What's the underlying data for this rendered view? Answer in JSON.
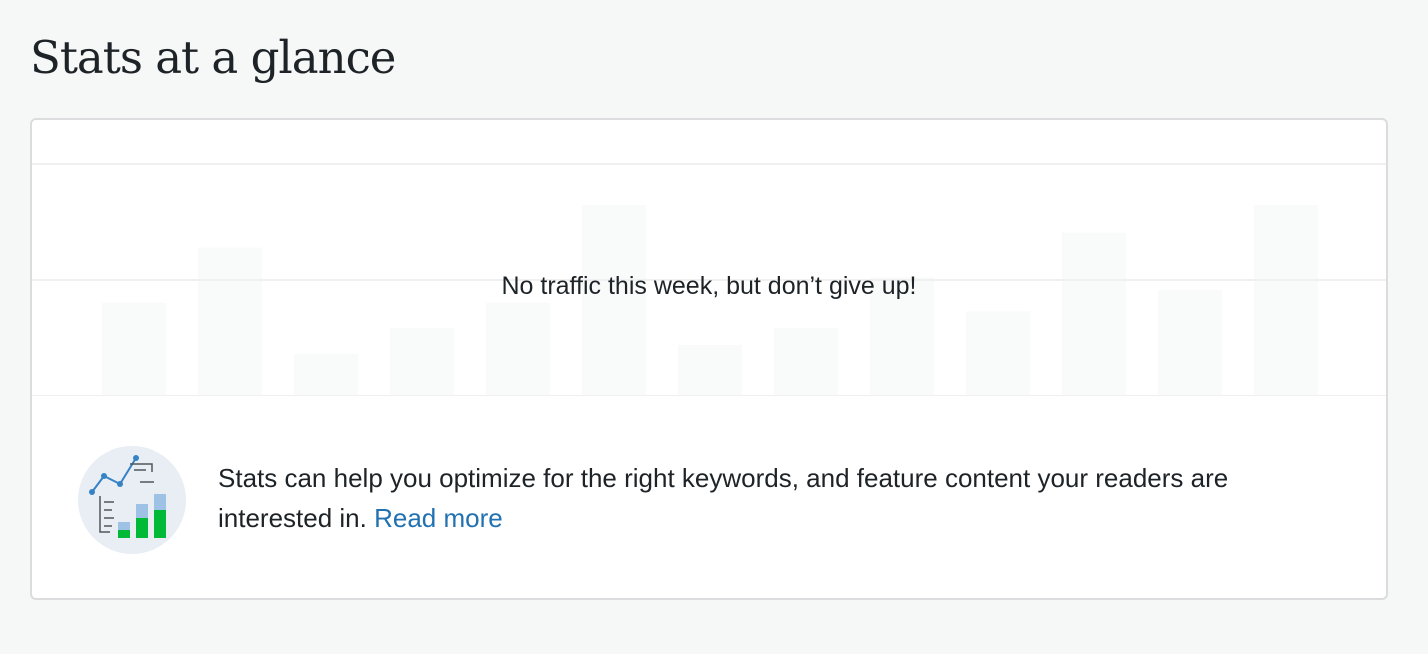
{
  "page": {
    "title": "Stats at a glance"
  },
  "traffic": {
    "empty_message": "No traffic this week, but don’t give up!",
    "placeholder_bars": [
      0.44,
      0.7,
      0.2,
      0.32,
      0.44,
      0.9,
      0.24,
      0.32,
      0.56,
      0.4,
      0.77,
      0.5,
      0.9
    ]
  },
  "info": {
    "text": "Stats can help you optimize for the right keywords, and feature content your readers are interested in.",
    "link_label": "Read more",
    "illustration_icon": "stats-chart-illustration-icon"
  },
  "colors": {
    "background": "#f6f7f7",
    "card_border": "#dcdcde",
    "link": "#2271b1",
    "bar_placeholder": "#f9fafa",
    "gridline": "#f0f0f1",
    "illustration_bg": "#e8eef4",
    "illustration_green": "#00ba37",
    "illustration_blue": "#9ec2e6",
    "illustration_line": "#3582c4"
  }
}
